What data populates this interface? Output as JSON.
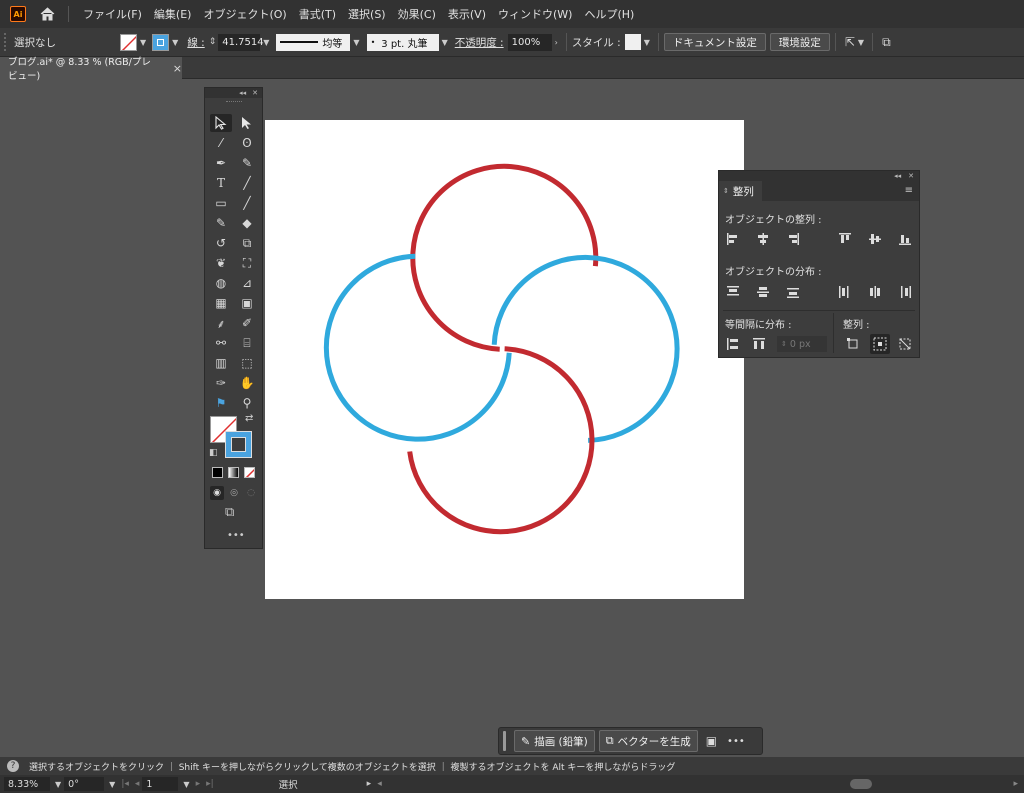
{
  "app": {
    "logo_text": "Ai"
  },
  "menu": [
    "ファイル(F)",
    "編集(E)",
    "オブジェクト(O)",
    "書式(T)",
    "選択(S)",
    "効果(C)",
    "表示(V)",
    "ウィンドウ(W)",
    "ヘルプ(H)"
  ],
  "control": {
    "selection": "選択なし",
    "stroke_label": "線 :",
    "stroke_value": "41.7514",
    "stroke_profile": "均等",
    "brush": "3 pt. 丸筆",
    "opacity_label": "不透明度 :",
    "opacity_value": "100%",
    "style_label": "スタイル :",
    "doc_setup": "ドキュメント設定",
    "prefs": "環境設定"
  },
  "document_tab": {
    "title": "ブログ.ai* @ 8.33 % (RGB/プレビュー)",
    "close": "×"
  },
  "align_panel": {
    "tab": "整列",
    "align_objects": "オブジェクトの整列 :",
    "distribute_objects": "オブジェクトの分布 :",
    "distribute_spacing": "等間隔に分布 :",
    "align_to": "整列 :",
    "spacing_value": "0 px"
  },
  "bottom_bar": {
    "draw_label": "描画 (鉛筆)",
    "vector_label": "ベクターを生成",
    "more": "•••"
  },
  "status": {
    "hint": "選択するオブジェクトをクリック ｜ Shift キーを押しながらクリックして複数のオブジェクトを選択 ｜ 複製するオブジェクトを Alt キーを押しながらドラッグ",
    "zoom": "8.33%",
    "rotation": "0°",
    "artboard": "1",
    "tool": "選択"
  },
  "colors": {
    "red": "#c22a30",
    "blue": "#2fa9dd",
    "accent": "#4aa3df"
  },
  "canvas": {
    "description_shapes": [
      "red-top-arc",
      "red-bottom-arc",
      "blue-left-arc",
      "blue-right-arc"
    ]
  }
}
